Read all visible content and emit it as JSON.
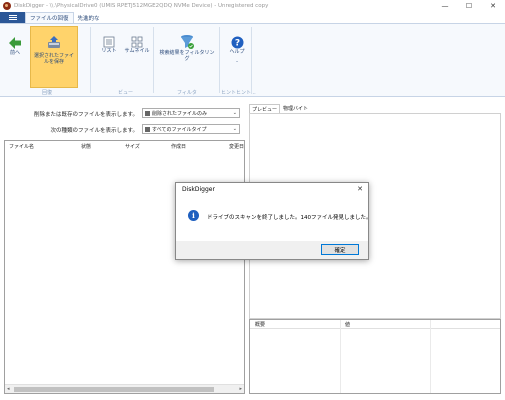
{
  "window": {
    "title": "DiskDigger - \\\\.\\PhysicalDrive0 (UMIS RPETJ512MGE2QDQ NVMe Device) - Unregistered copy",
    "minimize": "—",
    "maximize": "☐",
    "close": "✕"
  },
  "tabs": {
    "file_menu": "",
    "items": [
      "ファイルの回復",
      "先進的な"
    ]
  },
  "ribbon": {
    "back_label": "前へ",
    "save_label": "選択されたファイルを保存",
    "list_label": "リスト",
    "thumb_label": "サムネイル",
    "filter_label": "検索結果をフィルタリング",
    "help_label": "ヘルプ",
    "help_sub": "-",
    "groups": [
      "回復",
      "ビュー",
      "フィルタ",
      "ヒントヒント..."
    ]
  },
  "filters": {
    "row1_label": "削除または既存のファイルを表示します。",
    "row1_value": "削除されたファイルのみ",
    "row2_label": "次の種類のファイルを表示します。",
    "row2_value": "すべてのファイルタイプ"
  },
  "file_list": {
    "columns": [
      "ファイル名",
      "状態",
      "サイズ",
      "作成日",
      "変更日"
    ]
  },
  "preview": {
    "tabs": [
      "プレビュー",
      "物理バイト"
    ],
    "props_columns": [
      "概要",
      "値"
    ]
  },
  "dialog": {
    "title": "DiskDigger",
    "message": "ドライブのスキャンを終了しました。140ファイル発見しました。",
    "ok_label": "確定",
    "close": "✕",
    "icon": "i"
  },
  "colors": {
    "accent": "#2b5797",
    "save_highlight": "#ffd36b",
    "info_blue": "#1e5fbf"
  }
}
